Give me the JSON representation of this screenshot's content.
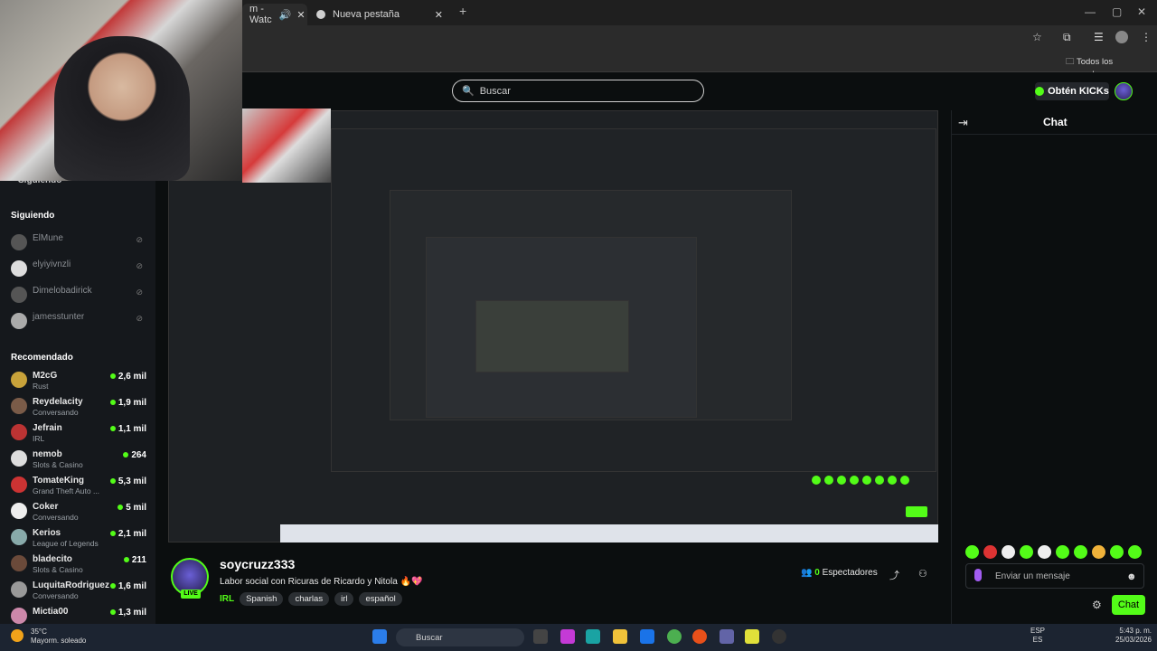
{
  "browser": {
    "tabs": [
      {
        "label": "m - Watc"
      },
      {
        "label": "Nueva pestaña"
      }
    ],
    "new_tab": "+",
    "bookmarks_label": "Todos los marcadores"
  },
  "header": {
    "search_placeholder": "Buscar",
    "get_kicks": "Obtén KICKs"
  },
  "sidebar": {
    "following_top": "Siguiendo",
    "following_title": "Siguiendo",
    "following": [
      {
        "name": "ElMune"
      },
      {
        "name": "elyiyivnzli"
      },
      {
        "name": "Dimelobadirick"
      },
      {
        "name": "jamesstunter"
      }
    ],
    "recommended_title": "Recomendado",
    "recommended": [
      {
        "name": "M2cG",
        "category": "Rust",
        "viewers": "2,6 mil"
      },
      {
        "name": "Reydelacity",
        "category": "Conversando",
        "viewers": "1,9 mil"
      },
      {
        "name": "Jefrain",
        "category": "IRL",
        "viewers": "1,1 mil"
      },
      {
        "name": "nemob",
        "category": "Slots & Casino",
        "viewers": "264"
      },
      {
        "name": "TomateKing",
        "category": "Grand Theft Auto ...",
        "viewers": "5,3 mil"
      },
      {
        "name": "Coker",
        "category": "Conversando",
        "viewers": "5 mil"
      },
      {
        "name": "Kerios",
        "category": "League of Legends",
        "viewers": "2,1 mil"
      },
      {
        "name": "bladecito",
        "category": "Slots & Casino",
        "viewers": "211"
      },
      {
        "name": "LuquitaRodriguez",
        "category": "Conversando",
        "viewers": "1,6 mil"
      },
      {
        "name": "Mictia00",
        "category": "",
        "viewers": "1,3 mil"
      }
    ]
  },
  "chat": {
    "title": "Chat",
    "input_placeholder": "Enviar un mensaje",
    "send_label": "Chat"
  },
  "stream": {
    "channel": "soycruzz333",
    "title": "Labor social con Ricuras de Ricardo y Nitola 🔥💖",
    "category": "IRL",
    "tags": [
      "Spanish",
      "charlas",
      "irl",
      "español"
    ],
    "viewers_count": "0",
    "viewers_label": "Espectadores",
    "live_badge": "LIVE"
  },
  "taskbar": {
    "temperature": "35°C",
    "weather": "Mayorm. soleado",
    "search": "Buscar",
    "lang_top": "ESP",
    "lang_bottom": "ES",
    "time": "5:43 p. m.",
    "date": "25/03/2026"
  },
  "colors": {
    "accent": "#53fc18",
    "background": "#0b0e0f",
    "sidebar": "#15181c"
  }
}
